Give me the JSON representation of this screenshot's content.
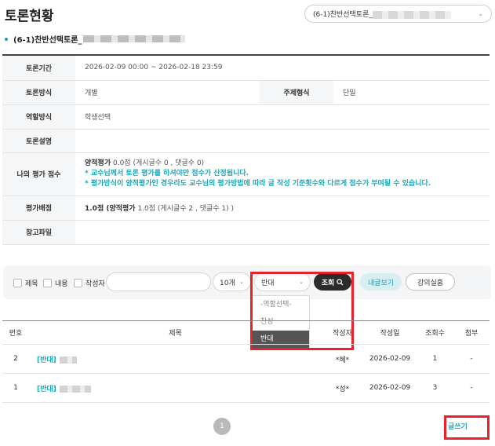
{
  "header": {
    "title": "토론현황",
    "course_select_value": "(6-1)찬반선택토론_"
  },
  "debate": {
    "name": "(6-1)찬반선택토론_"
  },
  "info": {
    "period_label": "토론기간",
    "period_value": "2026-02-09 00:00 ~ 2026-02-18 23:59",
    "method_label": "토론방식",
    "method_value": "개별",
    "topic_label": "주제형식",
    "topic_value": "단일",
    "role_label": "역할방식",
    "role_value": "학생선택",
    "desc_label": "토론설명",
    "desc_value": "",
    "myscore_label": "나의 평가 점수",
    "myscore_line_bold": "양적평가",
    "myscore_line_rest": " 0.0점 (게시글수 0 , 댓글수 0)",
    "myscore_note1": "* 교수님께서 토론 평가를 하셔야만 점수가 산정됩니다.",
    "myscore_note2": "* 평가방식이 양적평가인 경우라도 교수님의 평가방법에 따라 글 작성 기준횟수와 다르게 점수가 부여될 수 있습니다.",
    "alloc_label": "평가배점",
    "alloc_bold": "1.0점 (양적평가",
    "alloc_rest": " 1.0점 (게시글수 2 , 댓글수 1) )",
    "file_label": "참고파일",
    "file_value": ""
  },
  "filters": {
    "title_label": "제목",
    "content_label": "내용",
    "author_label": "작성자",
    "search_value": "",
    "page_size": "10개",
    "role_select": "반대",
    "search_button": "조회",
    "my_posts_button": "내글보기",
    "lecture_room_button": "강의실홈",
    "role_options": [
      "-역할선택-",
      "찬성",
      "반대"
    ]
  },
  "table": {
    "headers": [
      "번호",
      "제목",
      "작성자",
      "작성일",
      "조회수",
      "첨부"
    ],
    "rows": [
      {
        "no": "2",
        "tag": "[반대]",
        "author": "*혜*",
        "date": "2026-02-09",
        "views": "1",
        "attach": "-"
      },
      {
        "no": "1",
        "tag": "[반대]",
        "author": "*성*",
        "date": "2026-02-09",
        "views": "3",
        "attach": "-"
      }
    ]
  },
  "pagination": {
    "current": "1"
  },
  "write_button": "글쓰기",
  "colors": {
    "accent": "#1aa7b7",
    "highlight_border": "#e8212a",
    "dark_button": "#2b2b2b"
  },
  "icons": {
    "search": "search-icon",
    "chevron": "chevron-down-icon"
  }
}
